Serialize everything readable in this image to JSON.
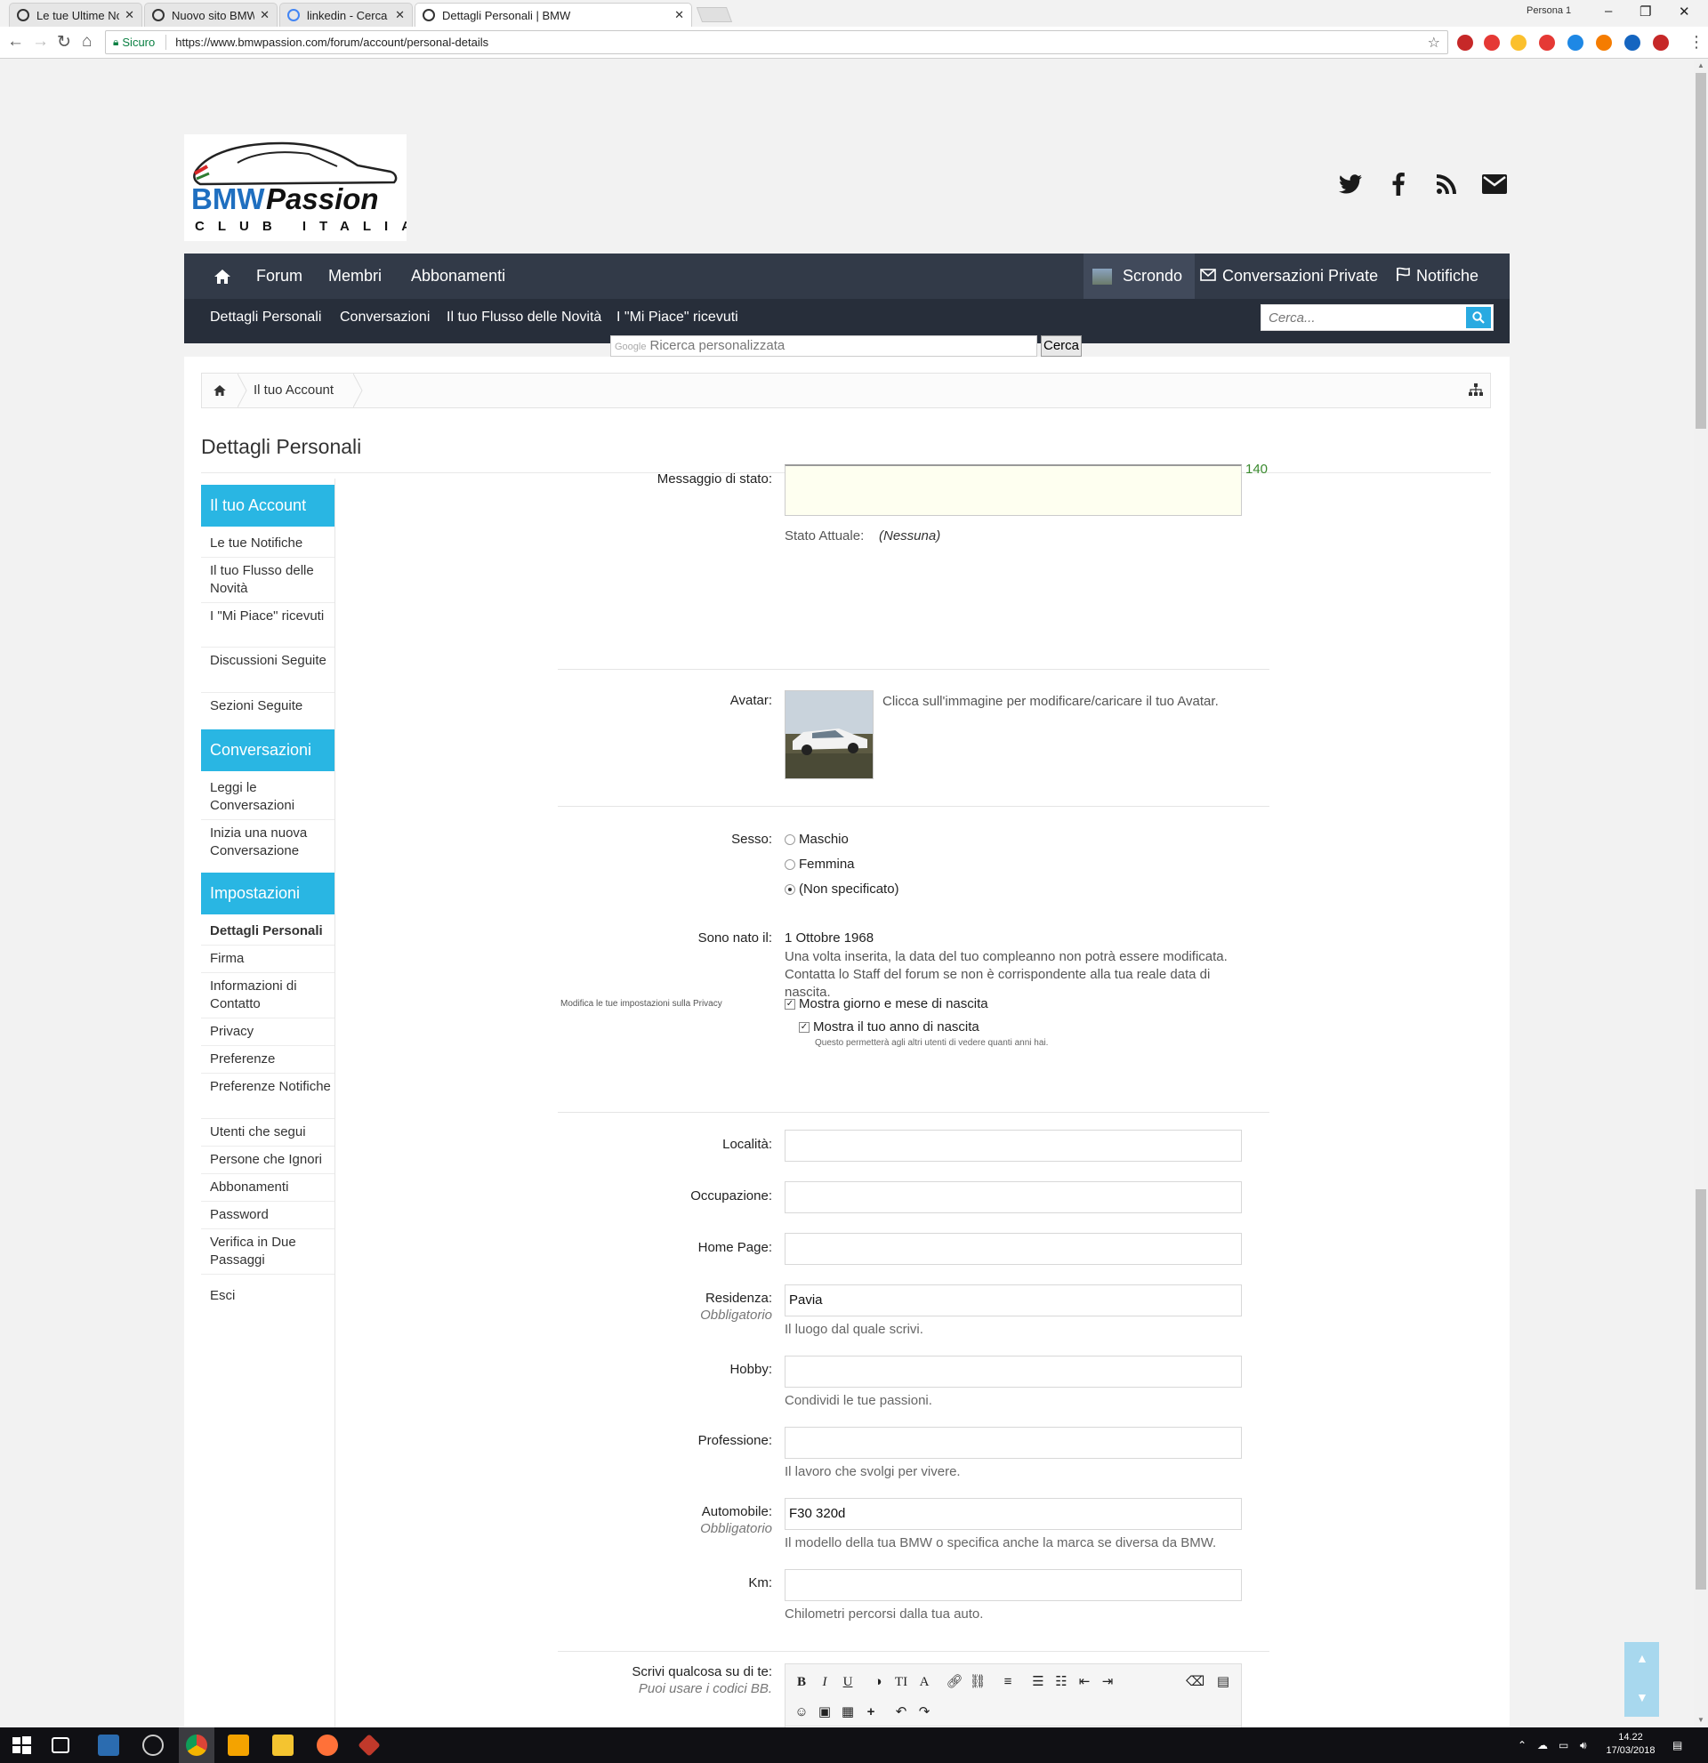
{
  "browser": {
    "tabs": [
      {
        "title": "Le tue Ultime Notifiche | B"
      },
      {
        "title": "Nuovo sito BMWpassion"
      },
      {
        "title": "linkedin - Cerca con Goog"
      },
      {
        "title": "Dettagli Personali | BMW"
      }
    ],
    "profile": "Persona 1",
    "secure_label": "Sicuro",
    "url": "https://www.bmwpassion.com/forum/account/personal-details"
  },
  "logo": {
    "brand_bmw": "BMW",
    "brand_passion": "Passion",
    "tagline": "CLUB ITALIA",
    "colors": {
      "bmw": "#1f6fc0",
      "passion": "#111111",
      "stripe_red": "#d62828"
    }
  },
  "nav": {
    "main": [
      "Forum",
      "Membri",
      "Abbonamenti"
    ],
    "user": "Scrondo",
    "private_conv": "Conversazioni Private",
    "notifications": "Notifiche",
    "sub": [
      "Dettagli Personali",
      "Conversazioni",
      "Il tuo Flusso delle Novità",
      "I \"Mi Piace\" ricevuti"
    ],
    "search_placeholder": "Cerca...",
    "colors": {
      "bar": "#323a48",
      "accent": "#29aae1"
    }
  },
  "google_search": {
    "brand": "Google",
    "placeholder": "Ricerca personalizzata",
    "button": "Cerca"
  },
  "breadcrumb": {
    "account": "Il tuo Account"
  },
  "page_title": "Dettagli Personali",
  "sidebar": {
    "account_head": "Il tuo Account",
    "account_links": [
      "Le tue Notifiche",
      "Il tuo Flusso delle Novità",
      "I \"Mi Piace\" ricevuti",
      "Discussioni Seguite",
      "Sezioni Seguite"
    ],
    "conv_head": "Conversazioni",
    "conv_links": [
      "Leggi le Conversazioni",
      "Inizia una nuova Conversazione"
    ],
    "settings_head": "Impostazioni",
    "settings_links": [
      "Dettagli Personali",
      "Firma",
      "Informazioni di Contatto",
      "Privacy",
      "Preferenze",
      "Preferenze Notifiche",
      "Utenti che segui",
      "Persone che Ignori",
      "Abbonamenti",
      "Password",
      "Verifica in Due Passaggi"
    ],
    "logout": "Esci",
    "colors": {
      "head": "#29b6e3"
    }
  },
  "form": {
    "status": {
      "label": "Messaggio di stato:",
      "counter": "140",
      "current_label": "Stato Attuale:",
      "current_value": "(Nessuna)"
    },
    "avatar": {
      "label": "Avatar:",
      "hint": "Clicca sull'immagine per modificare/caricare il tuo Avatar."
    },
    "gender": {
      "label": "Sesso:",
      "options": [
        "Maschio",
        "Femmina",
        "(Non specificato)"
      ],
      "selected": "(Non specificato)"
    },
    "birth": {
      "label": "Sono nato il:",
      "date": "1 Ottobre 1968",
      "note": "Una volta inserita, la data del tuo compleanno non potrà essere modificata. Contatta lo Staff del forum se non è corrispondente alla tua reale data di nascita."
    },
    "privacy": {
      "link": "Modifica le tue impostazioni sulla Privacy",
      "show_day_month": "Mostra giorno e mese di nascita",
      "show_year": "Mostra il tuo anno di nascita",
      "year_note": "Questo permetterà agli altri utenti di vedere quanti anni hai."
    },
    "location": {
      "label": "Località:",
      "value": ""
    },
    "occupation": {
      "label": "Occupazione:",
      "value": ""
    },
    "homepage": {
      "label": "Home Page:",
      "value": ""
    },
    "residence": {
      "label": "Residenza:",
      "required": "Obbligatorio",
      "value": "Pavia",
      "hint": "Il luogo dal quale scrivi."
    },
    "hobby": {
      "label": "Hobby:",
      "value": "",
      "hint": "Condividi le tue passioni."
    },
    "profession": {
      "label": "Professione:",
      "value": "",
      "hint": "Il lavoro che svolgi per vivere."
    },
    "car": {
      "label": "Automobile:",
      "required": "Obbligatorio",
      "value": "F30 320d",
      "hint": "Il modello della tua BMW o specifica anche la marca se diversa da BMW."
    },
    "km": {
      "label": "Km:",
      "value": "",
      "hint": "Chilometri percorsi dalla tua auto."
    },
    "about": {
      "label": "Scrivi qualcosa su di te:",
      "sub": "Puoi usare i codici BB."
    }
  },
  "taskbar": {
    "time": "14.22",
    "date": "17/03/2018"
  }
}
